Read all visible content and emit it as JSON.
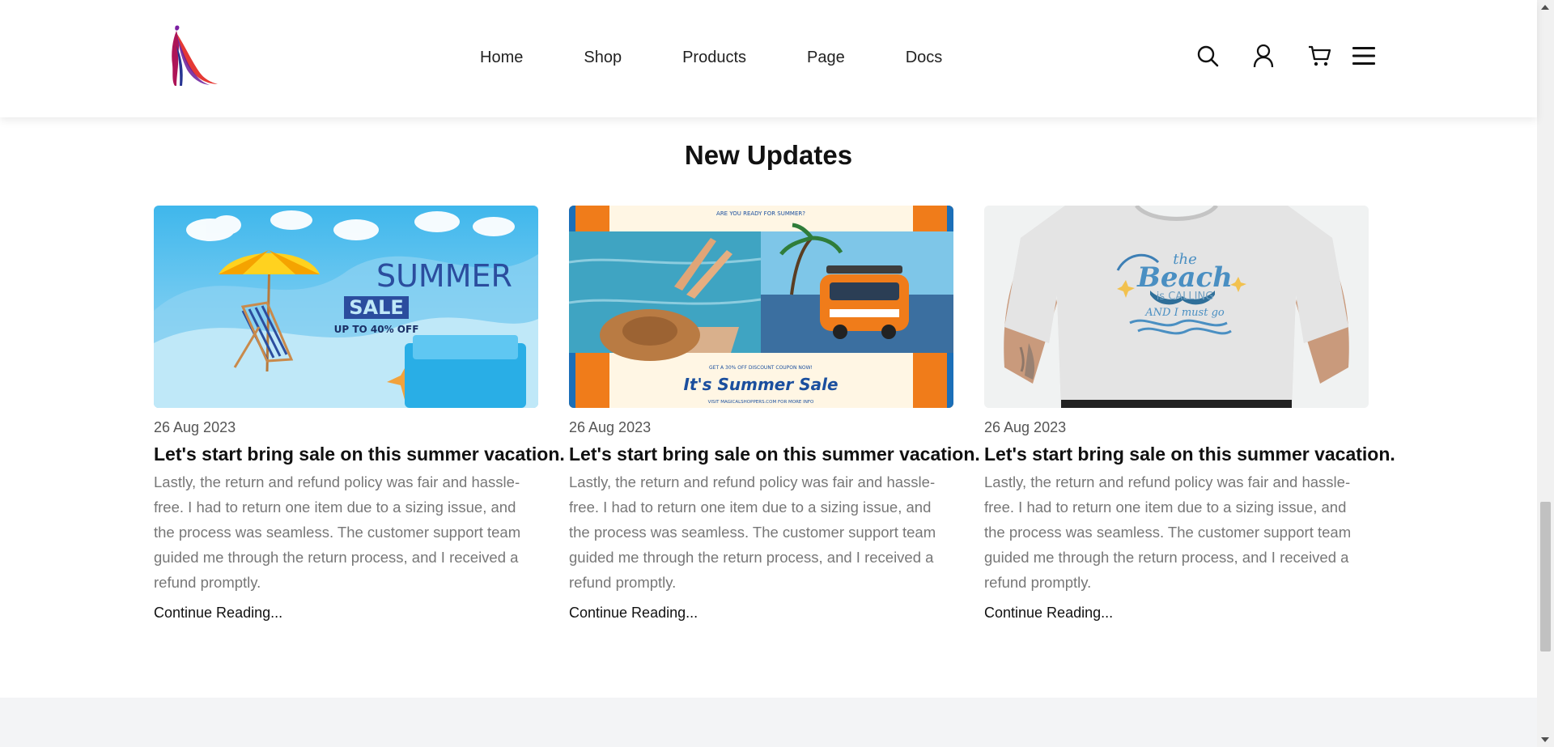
{
  "header": {
    "logo_icon": "fashion-woman-logo",
    "nav": [
      "Home",
      "Shop",
      "Products",
      "Page",
      "Docs"
    ],
    "icons": [
      "search-icon",
      "user-icon",
      "cart-icon",
      "menu-icon"
    ]
  },
  "section": {
    "title": "New Updates"
  },
  "posts": [
    {
      "image": "summer-sale-beach-banner",
      "image_text": {
        "line1": "SUMMER",
        "line2": "SALE",
        "line3": "UP TO 40% OFF"
      },
      "date": "26 Aug 2023",
      "title": "Let's start bring sale on this summer vacation.",
      "excerpt": "Lastly, the return and refund policy was fair and hassle-free. I had to return one item due to a sizing issue, and the process was seamless. The customer support team guided me through the return process, and I received a refund promptly.",
      "link": "Continue Reading..."
    },
    {
      "image": "summer-sale-collage-banner",
      "image_text": {
        "top": "ARE YOU READY FOR SUMMER?",
        "small": "GET A 30% OFF DISCOUNT COUPON NOW!",
        "headline": "It's Summer Sale",
        "footer": "VISIT MAGICALSHOPPERS.COM FOR MORE INFO"
      },
      "date": "26 Aug 2023",
      "title": "Let's start bring sale on this summer vacation.",
      "excerpt": "Lastly, the return and refund policy was fair and hassle-free. I had to return one item due to a sizing issue, and the process was seamless. The customer support team guided me through the return process, and I received a refund promptly.",
      "link": "Continue Reading..."
    },
    {
      "image": "beach-tshirt-photo",
      "image_text": {
        "line1": "the",
        "line2": "Beach",
        "line3": "is CALLING",
        "line4": "AND I must go"
      },
      "date": "26 Aug 2023",
      "title": "Let's start bring sale on this summer vacation.",
      "excerpt": "Lastly, the return and refund policy was fair and hassle-free. I had to return one item due to a sizing issue, and the process was seamless. The customer support team guided me through the return process, and I received a refund promptly.",
      "link": "Continue Reading..."
    }
  ],
  "colors": {
    "accent": "#c2185b",
    "sky": "#4fc3f7",
    "orange": "#f07c1a",
    "footer_band": "#f3f4f6"
  }
}
